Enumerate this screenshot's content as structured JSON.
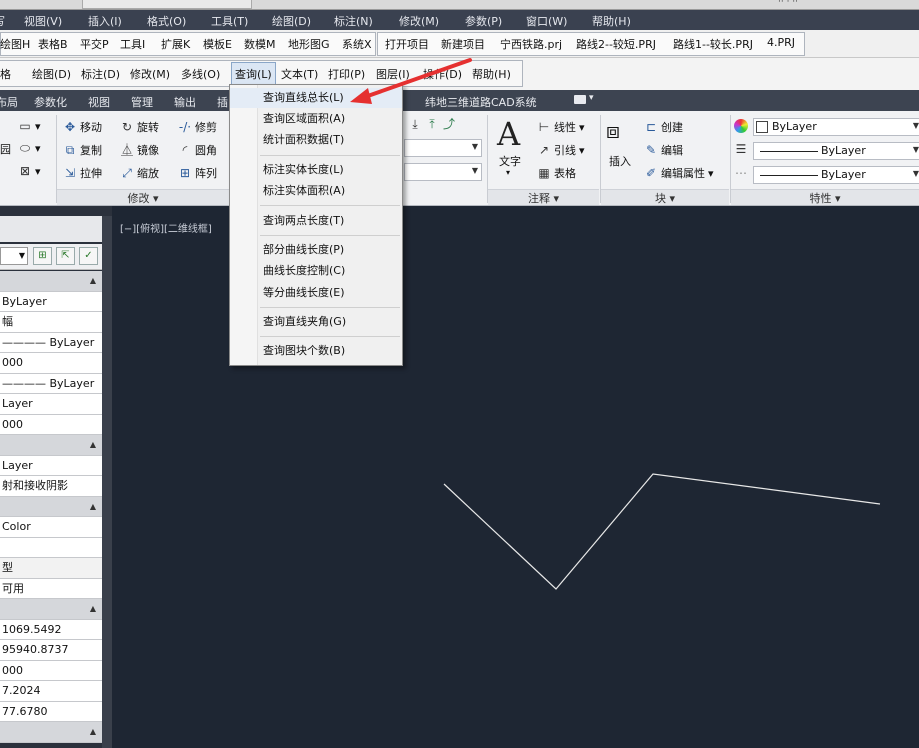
{
  "topstrip": {
    "title_right": "·· · ··"
  },
  "menubar": [
    "写",
    "视图(V)",
    "插入(I)",
    "格式(O)",
    "工具(T)",
    "绘图(D)",
    "标注(N)",
    "修改(M)",
    "参数(P)",
    "窗口(W)",
    "帮助(H)"
  ],
  "toolbar1": {
    "items": [
      "绘图H",
      "表格B",
      "平交P",
      "工具I",
      "扩展K",
      "模板E",
      "数模M",
      "地形图G",
      "系统X"
    ],
    "projects": [
      "打开项目",
      "新建项目",
      "宁西铁路.prj",
      "路线2--较短.PRJ",
      "路线1--较长.PRJ",
      "4.PRJ"
    ]
  },
  "toolbar2": [
    "格",
    "绘图(D)",
    "标注(D)",
    "修改(M)",
    "多线(O)",
    "查询(L)",
    "文本(T)",
    "打印(P)",
    "图层(I)",
    "操作(D)",
    "帮助(H)"
  ],
  "ribbon_tabs": [
    "布局",
    "参数化",
    "视图",
    "管理",
    "输出",
    "插"
  ],
  "ribbon_system_title": "纬地三维道路CAD系统",
  "ribbon": {
    "modify": {
      "move": "移动",
      "rotate": "旋转",
      "trim": "修剪",
      "copy": "复制",
      "mirror": "镜像",
      "fillet": "圆角",
      "stretch": "拉伸",
      "scale": "缩放",
      "array": "阵列",
      "footer": "修改 ▾",
      "left_fragment": "园"
    },
    "annotation": {
      "text": "文字",
      "linear": "线性",
      "leader": "引线",
      "table": "表格",
      "footer": "注释 ▾"
    },
    "block": {
      "insert": "插入",
      "create": "创建",
      "edit": "编辑",
      "edit_attr": "编辑属性",
      "footer": "块 ▾"
    },
    "properties": {
      "color": "ByLayer",
      "linetype": "ByLayer",
      "lineweight": "ByLayer",
      "footer": "特性 ▾"
    }
  },
  "left_panel": {
    "rows": [
      {
        "t": "",
        "sec": true
      },
      {
        "t": "ByLayer"
      },
      {
        "t": "幅"
      },
      {
        "t": "———— ByLayer"
      },
      {
        "t": "000"
      },
      {
        "t": "———— ByLayer"
      },
      {
        "t": "Layer"
      },
      {
        "t": "000"
      },
      {
        "t": "",
        "sec": true
      },
      {
        "t": "Layer"
      },
      {
        "t": "射和接收阴影"
      },
      {
        "t": "",
        "sec": true
      },
      {
        "t": "Color"
      },
      {
        "t": ""
      },
      {
        "t": "型",
        "gray": true
      },
      {
        "t": "可用"
      },
      {
        "t": "",
        "sec": true
      },
      {
        "t": "1069.5492"
      },
      {
        "t": "95940.8737"
      },
      {
        "t": "000"
      },
      {
        "t": "7.2024"
      },
      {
        "t": "77.6780"
      },
      {
        "t": "",
        "sec": true
      }
    ]
  },
  "canvas": {
    "view_label": "[−][俯视][二维线框]"
  },
  "dropdown": {
    "items": [
      "查询直线总长(L)",
      "查询区域面积(A)",
      "统计面积数据(T)",
      "标注实体长度(L)",
      "标注实体面积(A)",
      "查询两点长度(T)",
      "部分曲线长度(P)",
      "曲线长度控制(C)",
      "等分曲线长度(E)",
      "查询直线夹角(G)",
      "查询图块个数(B)"
    ]
  },
  "colors": {
    "menubar": "#3a4150",
    "canvas": "#1e2633",
    "annotation_arrow": "#e53030",
    "polyline": "#e8e8e8"
  }
}
